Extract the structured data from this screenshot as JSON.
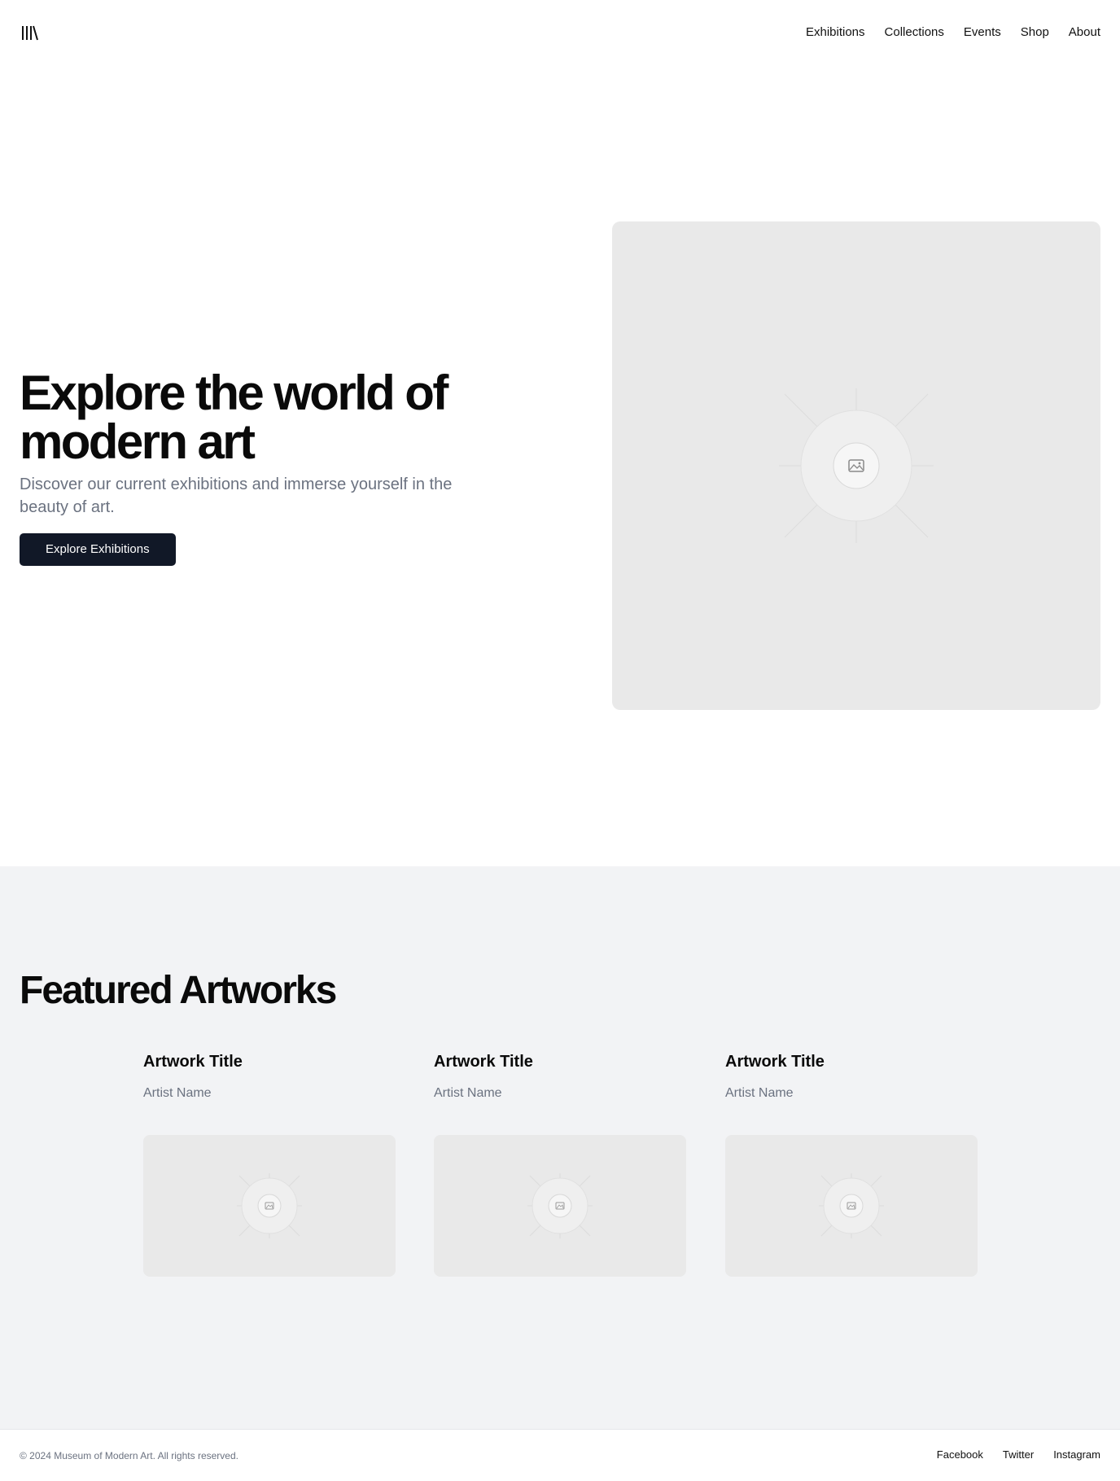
{
  "header": {
    "logo_icon": "library-icon",
    "nav": [
      {
        "label": "Exhibitions"
      },
      {
        "label": "Collections"
      },
      {
        "label": "Events"
      },
      {
        "label": "Shop"
      },
      {
        "label": "About"
      }
    ]
  },
  "hero": {
    "title": "Explore the world of modern art",
    "subtitle": "Discover our current exhibitions and immerse yourself in the beauty of art.",
    "cta_label": "Explore Exhibitions",
    "image_icon": "image-placeholder-icon"
  },
  "featured": {
    "title": "Featured Artworks",
    "cards": [
      {
        "title": "Artwork Title",
        "artist": "Artist Name"
      },
      {
        "title": "Artwork Title",
        "artist": "Artist Name"
      },
      {
        "title": "Artwork Title",
        "artist": "Artist Name"
      }
    ]
  },
  "footer": {
    "copyright": "© 2024 Museum of Modern Art. All rights reserved.",
    "links": [
      {
        "label": "Facebook"
      },
      {
        "label": "Twitter"
      },
      {
        "label": "Instagram"
      }
    ]
  },
  "colors": {
    "primary_button": "#111827",
    "muted_text": "#6b7280",
    "section_bg": "#f2f3f5",
    "placeholder_bg": "#e9e9e9"
  }
}
